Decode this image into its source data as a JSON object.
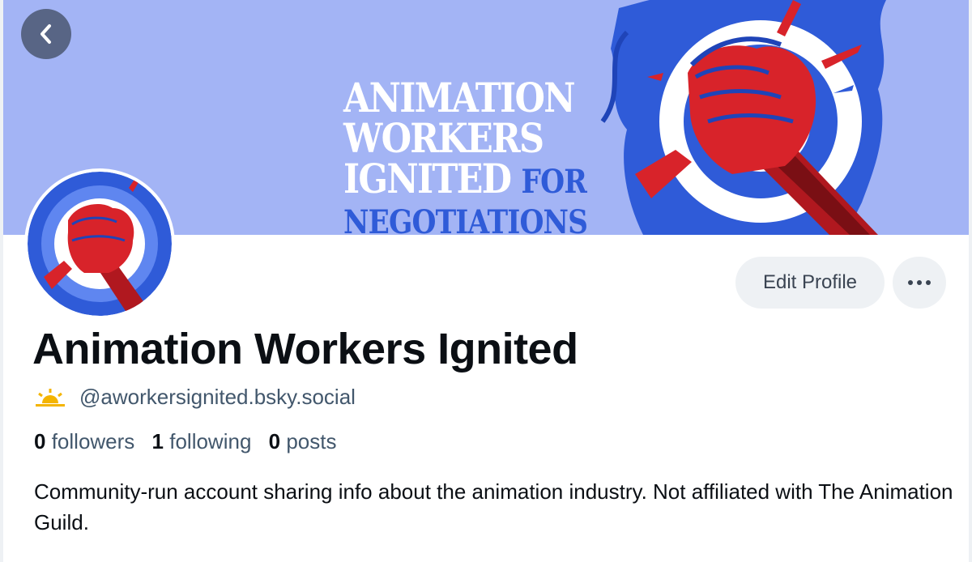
{
  "banner": {
    "line1": "ANIMATION",
    "line2": "WORKERS",
    "line3": "IGNITED",
    "line3_suffix": "FOR",
    "line4": "NEGOTIATIONS"
  },
  "profile": {
    "display_name": "Animation Workers Ignited",
    "handle": "@aworkersignited.bsky.social",
    "bio": "Community-run account sharing info about the animation industry. Not affiliated with The Animation Guild."
  },
  "stats": {
    "followers_count": "0",
    "followers_label": "followers",
    "following_count": "1",
    "following_label": "following",
    "posts_count": "0",
    "posts_label": "posts"
  },
  "actions": {
    "edit_profile_label": "Edit Profile"
  },
  "icons": {
    "back": "chevron-left-icon",
    "more": "ellipsis-icon",
    "handle_badge": "sun-icon"
  },
  "colors": {
    "banner_bg": "#a3b4f5",
    "accent_blue": "#2f5bd8",
    "fist_red": "#d8232a",
    "button_bg": "#eef1f4"
  }
}
